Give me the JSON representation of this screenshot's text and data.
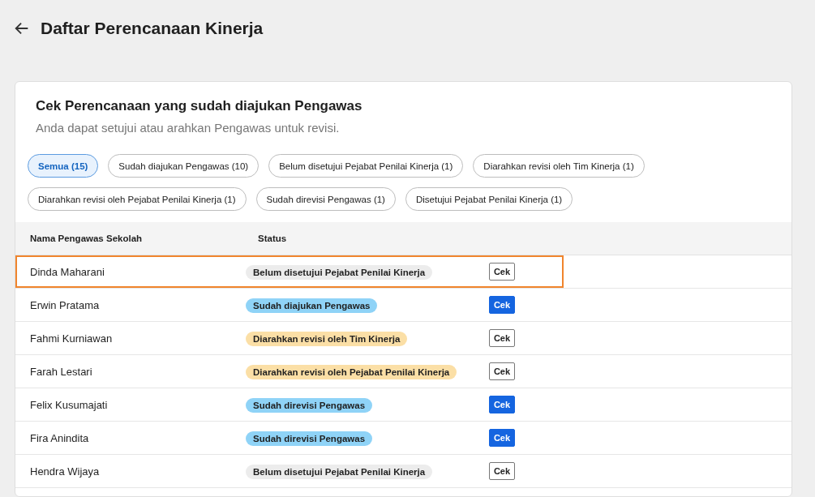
{
  "page": {
    "title": "Daftar Perencanaan Kinerja"
  },
  "card": {
    "heading": "Cek Perencanaan yang sudah diajukan Pengawas",
    "subheading": "Anda dapat setujui atau arahkan Pengawas untuk revisi."
  },
  "filters": [
    {
      "label": "Semua (15)",
      "selected": true
    },
    {
      "label": "Sudah diajukan Pengawas (10)",
      "selected": false
    },
    {
      "label": "Belum disetujui Pejabat Penilai Kinerja (1)",
      "selected": false
    },
    {
      "label": "Diarahkan revisi oleh Tim Kinerja (1)",
      "selected": false
    },
    {
      "label": "Diarahkan revisi oleh Pejabat Penilai Kinerja (1)",
      "selected": false
    },
    {
      "label": "Sudah direvisi Pengawas (1)",
      "selected": false
    },
    {
      "label": "Disetujui Pejabat Penilai Kinerja (1)",
      "selected": false
    }
  ],
  "table": {
    "columns": [
      "Nama Pengawas Sekolah",
      "Status"
    ],
    "rows": [
      {
        "name": "Dinda Maharani",
        "status": "Belum disetujui Pejabat Penilai Kinerja",
        "color": "#ececec",
        "action": "Cek",
        "kind": "outline",
        "highlighted": true
      },
      {
        "name": "Erwin Pratama",
        "status": "Sudah diajukan Pengawas",
        "color": "#8fd3f7",
        "action": "Cek",
        "kind": "primary",
        "highlighted": false
      },
      {
        "name": "Fahmi Kurniawan",
        "status": "Diarahkan revisi oleh Tim Kinerja",
        "color": "#fbdfa6",
        "action": "Cek",
        "kind": "outline",
        "highlighted": false
      },
      {
        "name": "Farah Lestari",
        "status": "Diarahkan revisi oleh Pejabat Penilai Kinerja",
        "color": "#fbdfa6",
        "action": "Cek",
        "kind": "outline",
        "highlighted": false
      },
      {
        "name": "Felix Kusumajati",
        "status": "Sudah direvisi Pengawas",
        "color": "#8fd3f7",
        "action": "Cek",
        "kind": "primary",
        "highlighted": false
      },
      {
        "name": "Fira Anindita",
        "status": "Sudah direvisi Pengawas",
        "color": "#8fd3f7",
        "action": "Cek",
        "kind": "primary",
        "highlighted": false
      },
      {
        "name": "Hendra Wijaya",
        "status": "Belum disetujui Pejabat Penilai Kinerja",
        "color": "#ececec",
        "action": "Cek",
        "kind": "outline",
        "highlighted": false
      }
    ]
  }
}
